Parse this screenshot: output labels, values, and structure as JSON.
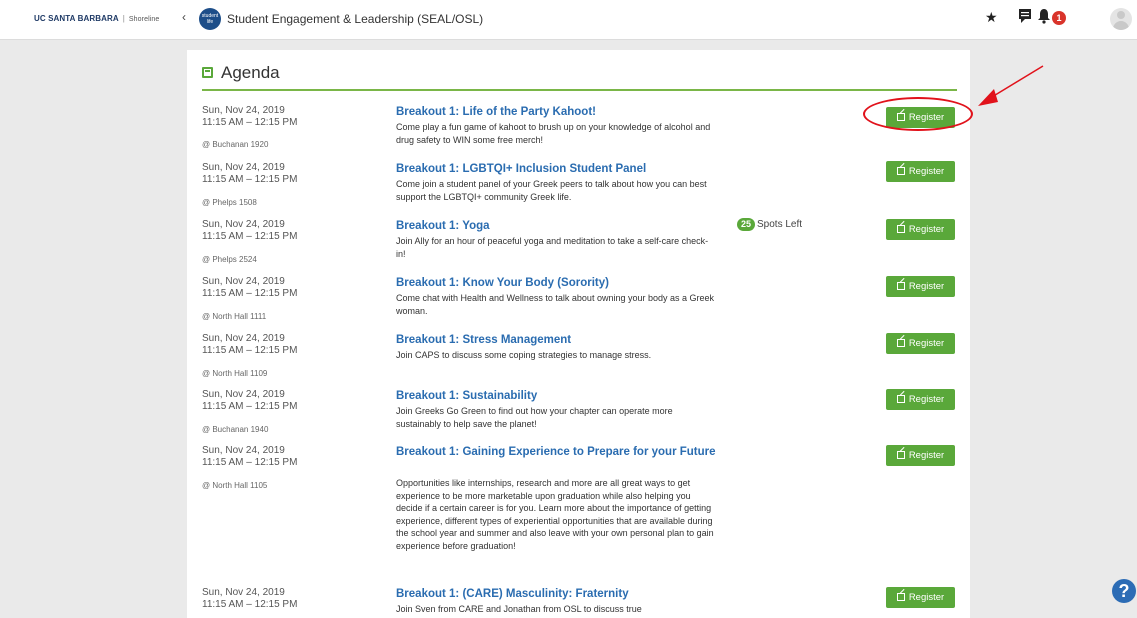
{
  "header": {
    "brand_main": "UC SANTA BARBARA",
    "brand_sep": "|",
    "brand_sub": "Shoreline",
    "back_glyph": "‹",
    "org_logo_text": "student life",
    "org_name": "Student Engagement & Leadership (SEAL/OSL)",
    "star_glyph": "★",
    "chat_glyph": "▤",
    "bell_glyph": "🔔",
    "notification_count": "1"
  },
  "agenda": {
    "title": "Agenda",
    "register_label": "Register",
    "events": [
      {
        "date": "Sun, Nov 24, 2019",
        "time": "11:15 AM – 12:15 PM",
        "location": "@ Buchanan 1920",
        "title": "Breakout 1: Life of the Party Kahoot!",
        "description": "Come play a fun game of kahoot to brush up on your knowledge of alcohol and drug safety to WIN some free merch!"
      },
      {
        "date": "Sun, Nov 24, 2019",
        "time": "11:15 AM – 12:15 PM",
        "location": "@ Phelps 1508",
        "title": "Breakout 1: LGBTQI+ Inclusion Student Panel",
        "description": "Come join a student panel of your Greek peers to talk about how you can best support the LGBTQI+ community Greek life."
      },
      {
        "date": "Sun, Nov 24, 2019",
        "time": "11:15 AM – 12:15 PM",
        "location": "@ Phelps 2524",
        "title": "Breakout 1: Yoga",
        "description": "Join Ally for an hour of peaceful yoga and meditation to take a self-care check-in!",
        "spots_count": "25",
        "spots_label": "Spots Left"
      },
      {
        "date": "Sun, Nov 24, 2019",
        "time": "11:15 AM – 12:15 PM",
        "location": "@ North Hall 1111",
        "title": "Breakout 1: Know Your Body (Sorority)",
        "description": "Come chat with Health and Wellness to talk about owning your body as a Greek woman."
      },
      {
        "date": "Sun, Nov 24, 2019",
        "time": "11:15 AM – 12:15 PM",
        "location": "@ North Hall 1109",
        "title": "Breakout 1: Stress Management",
        "description": "Join CAPS to discuss some coping strategies to manage stress."
      },
      {
        "date": "Sun, Nov 24, 2019",
        "time": "11:15 AM – 12:15 PM",
        "location": "@ Buchanan 1940",
        "title": "Breakout 1: Sustainability",
        "description": "Join Greeks Go Green to find out how your chapter can operate more sustainably to help save the planet!"
      },
      {
        "date": "Sun, Nov 24, 2019",
        "time": "11:15 AM – 12:15 PM",
        "location": "@ North Hall 1105",
        "title": "Breakout 1: Gaining Experience to Prepare for your Future",
        "description": "Opportunities like internships, research and more are all great ways to get experience to be more marketable upon graduation while also helping you decide if a certain career is for you. Learn more about the importance of getting experience, different types of experiential opportunities that are available during the school year and summer and also leave with your own personal plan to gain experience before graduation!"
      },
      {
        "date": "Sun, Nov 24, 2019",
        "time": "11:15 AM – 12:15 PM",
        "title": "Breakout 1: (CARE) Masculinity: Fraternity",
        "description": "Join Sven from CARE and Jonathan from OSL to discuss true"
      }
    ]
  },
  "help_glyph": "?",
  "colors": {
    "accent_green": "#5aa83a",
    "link_blue": "#2a6cb0",
    "annotation_red": "#e1121b"
  }
}
